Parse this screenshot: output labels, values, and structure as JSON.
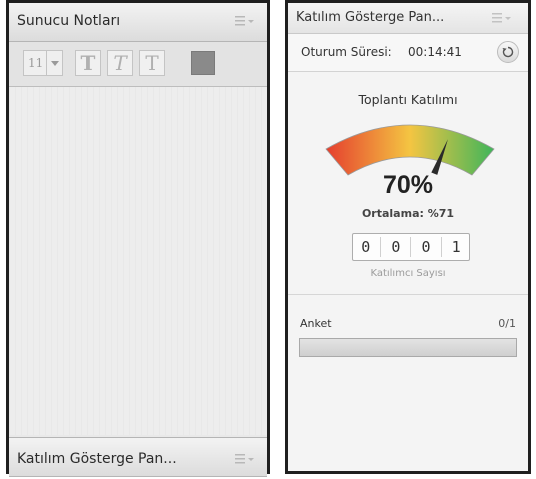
{
  "left_panel": {
    "title": "Sunucu Notları",
    "toolbar": {
      "font_size": "11",
      "bold_glyph": "T",
      "italic_glyph": "T",
      "underline_glyph": "T",
      "text_color": "#8a8a8a"
    },
    "bottom_title": "Katılım Gösterge Pan..."
  },
  "right_panel": {
    "title": "Katılım Gösterge Pan...",
    "session_label": "Oturum Süresi:",
    "session_time": "00:14:41",
    "meeting_label": "Toplantı Katılımı",
    "gauge_value": 0.7,
    "percent": "70%",
    "average": "Ortalama: %71",
    "participant_digits": [
      "0",
      "0",
      "0",
      "1"
    ],
    "participant_label": "Katılımcı Sayısı",
    "poll_label": "Anket",
    "poll_count": "0/1",
    "poll_progress": 0
  },
  "icons": {
    "menu": "menu-icon",
    "refresh": "refresh-icon"
  },
  "colors": {
    "gauge_low": "#e53e2e",
    "gauge_mid": "#f4c542",
    "gauge_high": "#3fb55a"
  }
}
